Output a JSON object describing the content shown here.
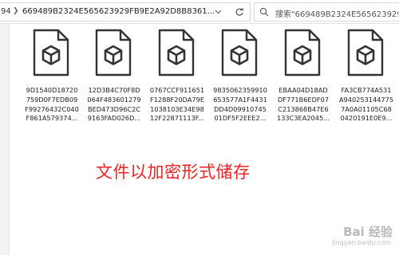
{
  "address_bar": {
    "truncated_segment": "94",
    "current_folder": "669489B2324E565623929FB9E2A92D8B8361..."
  },
  "search": {
    "value": "搜索\"669489B2324E565623929..."
  },
  "files": [
    {
      "name": "9D1540D18720\n759D0F7EDB09\nF99276432C040\nF861A579374..."
    },
    {
      "name": "12D3B4C70F8D\n064F483601279\nBED473D96C2C\n9163FAD026D..."
    },
    {
      "name": "0767CCF911651\nF1288F20DA79E\n1038103E34E98\n12F22871113F..."
    },
    {
      "name": "9835062359910\n653577A1F4431\nDD4D09910745\n01DF5F2EEE2..."
    },
    {
      "name": "EBAA04D18AD\nDF771B6EDF07\nC213868B47E6\n133C3EA2045..."
    },
    {
      "name": "FA3CB774A531\nA940253144775\n7A0A01105C68\n0420191E0E9..."
    }
  ],
  "caption": "文件以加密形式储存",
  "watermark": {
    "brand": "Bai 经验",
    "url": "jingyan.baidu.com"
  },
  "icons": {
    "file": "unknown-file-cube-icon",
    "refresh": "refresh-icon",
    "dropdown": "chevron-down-icon",
    "search": "search-icon",
    "breadcrumb_separator": "chevron-right-icon"
  },
  "colors": {
    "caption": "#ee2222",
    "file_icon_stroke": "#333333"
  }
}
